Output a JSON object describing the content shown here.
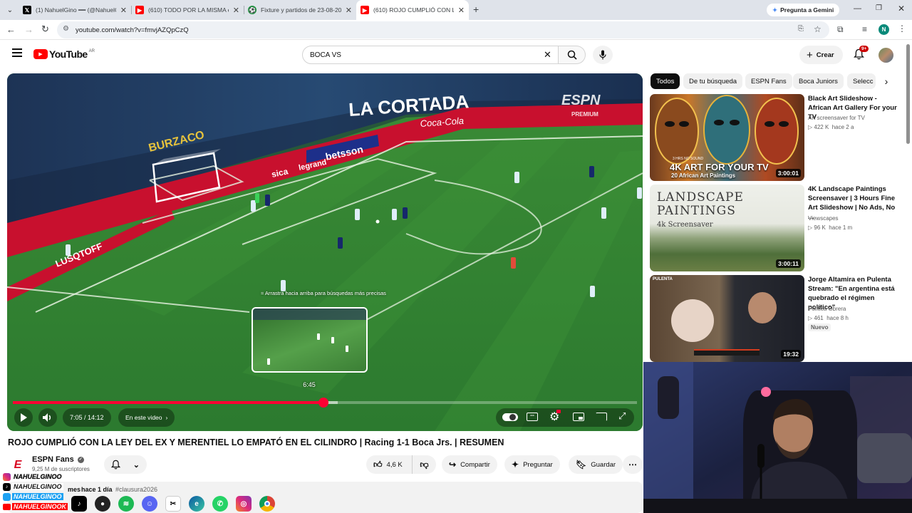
{
  "browser": {
    "tabs": [
      {
        "title": "(1) NahuelGino ━━ (@NahuelGino)",
        "favicon": "x-icon",
        "active": false
      },
      {
        "title": "(610) TODO POR LA MISMA en",
        "favicon": "youtube-icon",
        "active": false
      },
      {
        "title": "Fixture y partidos de 23-08-2025",
        "favicon": "soccer-icon",
        "active": false
      },
      {
        "title": "(610) ROJO CUMPLIÓ CON LA LEY",
        "favicon": "youtube-icon",
        "active": true
      }
    ],
    "gemini_label": "Pregunta a Gemini",
    "url": "youtube.com/watch?v=fmvjAZQpCzQ",
    "profile_initial": "N"
  },
  "youtube": {
    "logo_text": "YouTube",
    "country": "AR",
    "search_value": "BOCA VS",
    "create_label": "Crear",
    "notif_badge": "9+"
  },
  "player": {
    "drag_hint": "Arrastra hacia arriba para búsquedas más precisas",
    "preview_time": "6:45",
    "time_display": "7:05 / 14:12",
    "chapter_label": "En este video",
    "progress_fraction": 0.498,
    "buffer_fraction": 0.52,
    "overlay_brand": "ESPN",
    "overlay_tag": "PREMIUM",
    "stadium_banner": "LA CORTADA",
    "sponsors": [
      "betsson",
      "legrand",
      "sica",
      "LUSQTOFF",
      "Coca-Cola",
      "BURZACO"
    ]
  },
  "video": {
    "title": "ROJO CUMPLIÓ CON LA LEY DEL EX Y MERENTIEL LO EMPATÓ EN EL CILINDRO | Racing 1-1 Boca Jrs. | RESUMEN",
    "channel": "ESPN Fans",
    "subscribers": "9,25 M de suscriptores",
    "likes": "4,6 K",
    "share_label": "Compartir",
    "ask_label": "Preguntar",
    "save_label": "Guardar",
    "desc_views": "mes",
    "desc_date": "hace 1 día",
    "desc_tag": "#clausura2026"
  },
  "chips": [
    "Todos",
    "De tu búsqueda",
    "ESPN Fans",
    "Boca Juniors",
    "Selecc"
  ],
  "recommendations": [
    {
      "title": "Black Art Slideshow - African Art Gallery For your TV",
      "channel": "Art screensaver for TV",
      "views": "422 K",
      "age": "hace 2 a",
      "duration": "3:00:01",
      "thumb_line1": "3 HRS NO SOUND",
      "thumb_line2": "4K ART FOR YOUR TV",
      "thumb_line3": "20 African Art Paintings"
    },
    {
      "title": "4K Landscape Paintings Screensaver | 3 Hours Fine Art Slideshow | No Ads, No ...",
      "channel": "Viewscapes",
      "views": "96 K",
      "age": "hace 1 m",
      "duration": "3:00:11",
      "thumb_line1": "LANDSCAPE",
      "thumb_line2": "PAINTINGS",
      "thumb_line3": "4k Screensaver"
    },
    {
      "title": "Jorge Altamira en Pulenta Stream: \"En argentina está quebrado el régimen político\"",
      "channel": "Política Obrera",
      "views": "461",
      "age": "hace 8 h",
      "duration": "19:32",
      "badge": "Nuevo",
      "thumb_line1": "PULENTA"
    }
  ],
  "overlay_socials": [
    "NAHUELGINOO",
    "NAHUELGINOO",
    "NAHUELGINOO",
    "NAHUELGINOOK"
  ],
  "colors": {
    "youtube_red": "#ff0000",
    "progress": "#ff0033",
    "pitch": "#2f7d30",
    "chip_selected": "#0f0f0f"
  }
}
